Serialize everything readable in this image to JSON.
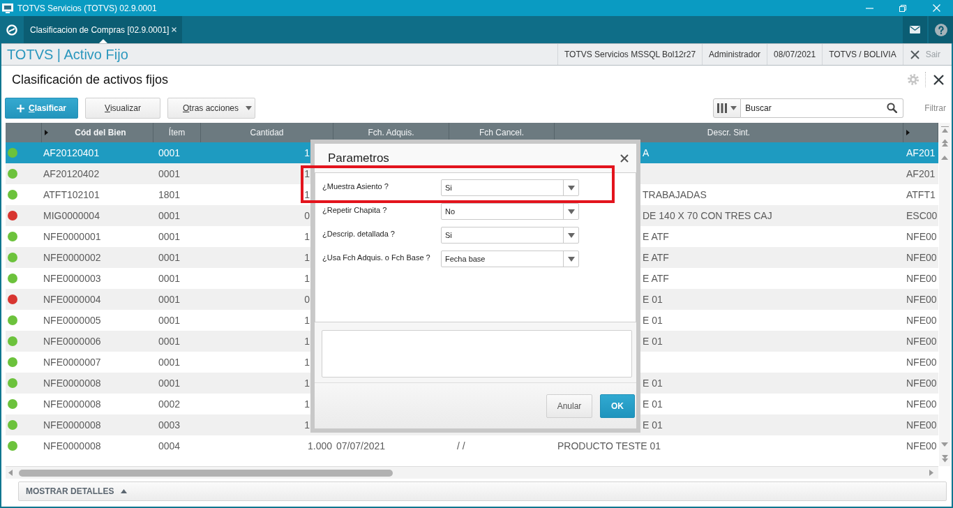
{
  "window": {
    "title": "TOTVS Servicios (TOTVS) 02.9.0001"
  },
  "tabs": [
    {
      "label": "Clasificacion de Compras [02.9.0001]",
      "selected": true
    }
  ],
  "app_header": {
    "title": "TOTVS | Activo Fijo",
    "info": [
      "TOTVS Servicios MSSQL Bol12r27",
      "Administrador",
      "08/07/2021",
      "TOTVS / BOLIVIA"
    ],
    "exit": "Sair"
  },
  "page": {
    "title": "Clasificación de activos fijos"
  },
  "toolbar": {
    "buttons": [
      {
        "label": "Clasificar",
        "kind": "primary"
      },
      {
        "label": "Visualizar",
        "kind": "plain"
      },
      {
        "label": "Otras acciones",
        "kind": "menu"
      }
    ],
    "search": {
      "placeholder": "Buscar"
    },
    "filter": "Filtrar"
  },
  "table": {
    "columns": [
      "Cód del Bien",
      "Ítem",
      "Cantidad",
      "Fch. Adquis.",
      "Fch Cancel.",
      "Descr. Sint."
    ],
    "rows": [
      {
        "color": "#6cc23c",
        "selected": true,
        "code": "AF20120401",
        "item": "0001",
        "quantity": "1",
        "description": "A",
        "column_8": "AF201"
      },
      {
        "color": "#6cc23c",
        "selected": false,
        "code": "AF20120402",
        "item": "0001",
        "quantity": "1",
        "column_8": "AF201"
      },
      {
        "color": "#6cc23c",
        "selected": false,
        "code": "ATFT102101",
        "item": "1801",
        "quantity": "1",
        "description": "TRABAJADAS",
        "column_8": "ATFT1"
      },
      {
        "color": "#d83530",
        "selected": false,
        "code": "MIG0000004",
        "item": "0001",
        "quantity": "0",
        "description": "DE 140 X 70 CON TRES CAJ",
        "column_8": "ESC00"
      },
      {
        "color": "#6cc23c",
        "selected": false,
        "code": "NFE0000001",
        "item": "0001",
        "quantity": "1",
        "description": "E ATF",
        "column_8": "NFE00"
      },
      {
        "color": "#6cc23c",
        "selected": false,
        "code": "NFE0000002",
        "item": "0001",
        "quantity": "1",
        "description": "E ATF",
        "column_8": "NFE00"
      },
      {
        "color": "#6cc23c",
        "selected": false,
        "code": "NFE0000003",
        "item": "0001",
        "quantity": "1",
        "description": "E ATF",
        "column_8": "NFE00"
      },
      {
        "color": "#d83530",
        "selected": false,
        "code": "NFE0000004",
        "item": "0001",
        "quantity": "0",
        "description": "E 01",
        "column_8": "NFE00"
      },
      {
        "color": "#6cc23c",
        "selected": false,
        "code": "NFE0000005",
        "item": "0001",
        "quantity": "1",
        "description": "E 01",
        "column_8": "NFE00"
      },
      {
        "color": "#6cc23c",
        "selected": false,
        "code": "NFE0000006",
        "item": "0001",
        "quantity": "1",
        "description": "E 01",
        "column_8": "NFE00"
      },
      {
        "color": "#6cc23c",
        "selected": false,
        "code": "NFE0000007",
        "item": "0001",
        "quantity": "1",
        "column_8": "NFE00"
      },
      {
        "color": "#6cc23c",
        "selected": false,
        "code": "NFE0000008",
        "item": "0001",
        "quantity": "1",
        "description": "E 01",
        "column_8": "NFE00"
      },
      {
        "color": "#6cc23c",
        "selected": false,
        "code": "NFE0000008",
        "item": "0002",
        "quantity": "1",
        "description": "E 01",
        "column_8": "NFE00"
      },
      {
        "color": "#6cc23c",
        "selected": false,
        "code": "NFE0000008",
        "item": "0003",
        "quantity": "1",
        "description": "E 01",
        "column_8": "NFE00"
      },
      {
        "color": "#6cc23c",
        "selected": false,
        "code": "NFE0000008",
        "item": "0004",
        "quantity": "1.000",
        "acquired": "07/07/2021",
        "cancelled": "/ /",
        "description": "PRODUCTO TESTE 01",
        "column_8": "NFE00"
      }
    ]
  },
  "details_bar": {
    "label": "MOSTRAR DETALLES"
  },
  "dialog": {
    "title": "Parametros",
    "fields": [
      {
        "label": "¿Muestra Asiento ?",
        "value": "Si",
        "highlighted": true
      },
      {
        "label": "¿Repetir Chapita ?",
        "value": "No",
        "highlighted": false
      },
      {
        "label": "¿Descrip. detallada ?",
        "value": "Si",
        "highlighted": false
      },
      {
        "label": "¿Usa Fch Adquis. o Fch Base ?",
        "value": "Fecha base",
        "highlighted": false
      }
    ],
    "buttons": [
      {
        "label": "Anular",
        "kind": "plain"
      },
      {
        "label": "OK",
        "kind": "primary"
      }
    ]
  }
}
